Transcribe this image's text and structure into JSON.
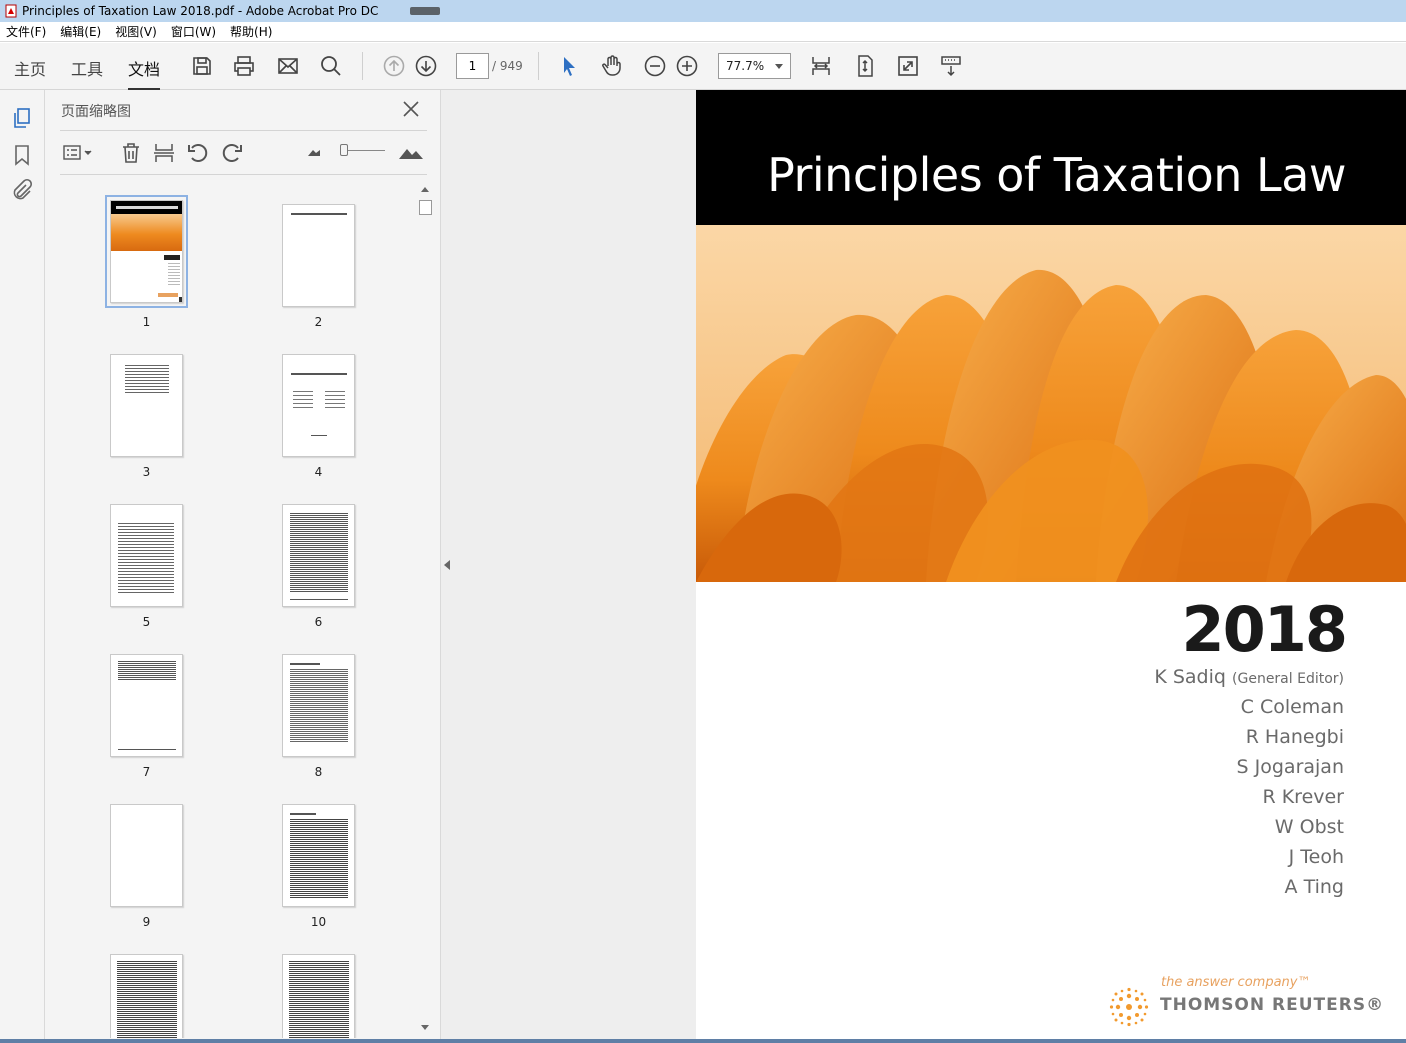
{
  "window": {
    "title": "Principles of Taxation Law 2018.pdf - Adobe Acrobat Pro DC"
  },
  "menu": [
    "文件(F)",
    "编辑(E)",
    "视图(V)",
    "窗口(W)",
    "帮助(H)"
  ],
  "toolbar": {
    "tabs": {
      "home": "主页",
      "tools": "工具",
      "document": "文档"
    },
    "page_current": "1",
    "page_total": "/ 949",
    "zoom": "77.7%",
    "icons": [
      "save-icon",
      "print-icon",
      "email-icon",
      "search-icon",
      "prev-page-icon",
      "next-page-icon",
      "select-arrow-icon",
      "hand-icon",
      "zoom-out-icon",
      "zoom-in-icon",
      "fit-width-icon",
      "fit-page-icon",
      "fullscreen-icon",
      "scroll-mode-icon"
    ]
  },
  "panel": {
    "title": "页面缩略图",
    "thumbnails": [
      "1",
      "2",
      "3",
      "4",
      "5",
      "6",
      "7",
      "8",
      "9",
      "10"
    ],
    "selected_page": "1"
  },
  "document": {
    "title": "Principles of Taxation Law",
    "year": "2018",
    "authors": [
      {
        "name": "K Sadiq",
        "role": "(General Editor)"
      },
      {
        "name": "C Coleman"
      },
      {
        "name": "R Hanegbi"
      },
      {
        "name": "S Jogarajan"
      },
      {
        "name": "R Krever"
      },
      {
        "name": "W Obst"
      },
      {
        "name": "J Teoh"
      },
      {
        "name": "A Ting"
      }
    ],
    "publisher_tagline": "the answer company™",
    "publisher_name": "THOMSON REUTERS®",
    "colors": {
      "band": "#000000",
      "petal": "#f08a1c",
      "background_peach": "#f7c98e"
    }
  }
}
